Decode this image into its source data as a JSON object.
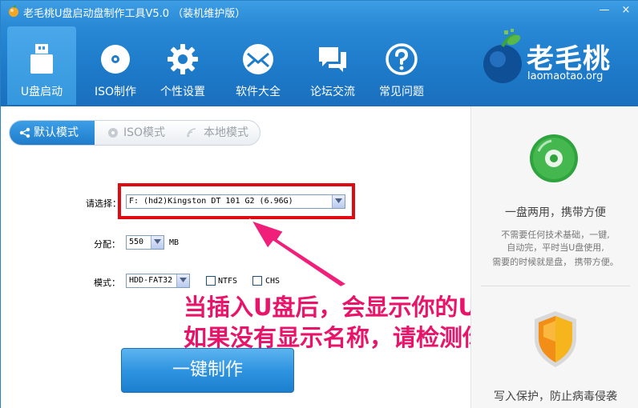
{
  "window": {
    "title": "老毛桃U盘启动盘制作工具V5.0 （装机维护版）",
    "minimize_glyph": "—",
    "close_glyph": "×"
  },
  "toolbar": {
    "items": [
      {
        "label": "U盘启动",
        "icon": "usb-drive-icon",
        "active": true
      },
      {
        "label": "ISO制作",
        "icon": "disc-icon",
        "active": false
      },
      {
        "label": "个性设置",
        "icon": "gear-icon",
        "active": false
      },
      {
        "label": "软件大全",
        "icon": "envelope-icon",
        "active": false
      },
      {
        "label": "论坛交流",
        "icon": "chat-bubbles-icon",
        "active": false
      },
      {
        "label": "常见问题",
        "icon": "question-icon",
        "active": false
      }
    ]
  },
  "logo": {
    "name": "老毛桃",
    "domain": "laomaotao.org"
  },
  "modes": [
    {
      "label": "默认模式",
      "icon": "share-icon",
      "active": true
    },
    {
      "label": "ISO模式",
      "icon": "disc-small-icon",
      "active": false
    },
    {
      "label": "本地模式",
      "icon": "signal-icon",
      "active": false
    }
  ],
  "form": {
    "device_label": "请选择：",
    "device_value": "F: (hd2)Kingston DT 101 G2 (6.96G)",
    "alloc_label": "分配：",
    "alloc_value": "550",
    "alloc_unit": "MB",
    "mode_label": "模式：",
    "mode_value": "HDD-FAT32",
    "ntfs_label": "NTFS",
    "chs_label": "CHS"
  },
  "make_button": "一键制作",
  "annotation": {
    "line1": "当插入U盘后，会显示你的U盘名称",
    "line2": "如果没有显示名称，请检测你的U盘"
  },
  "features": [
    {
      "title": "一盘两用，携带方便",
      "desc_lines": [
        "不需要任何技术基础，一键,",
        "自动完，平时当U盘使用,",
        "需要的时候就是盘，   携带方便。"
      ],
      "icon": "cd-icon"
    },
    {
      "title": "写入保护，防止病毒侵袭",
      "icon": "shield-icon"
    }
  ],
  "colors": {
    "toolbar_blue": "#1e7ccb",
    "annotation_pink": "#e8146a",
    "highlight_red": "#e00a12",
    "button_blue": "#2f94e0"
  }
}
